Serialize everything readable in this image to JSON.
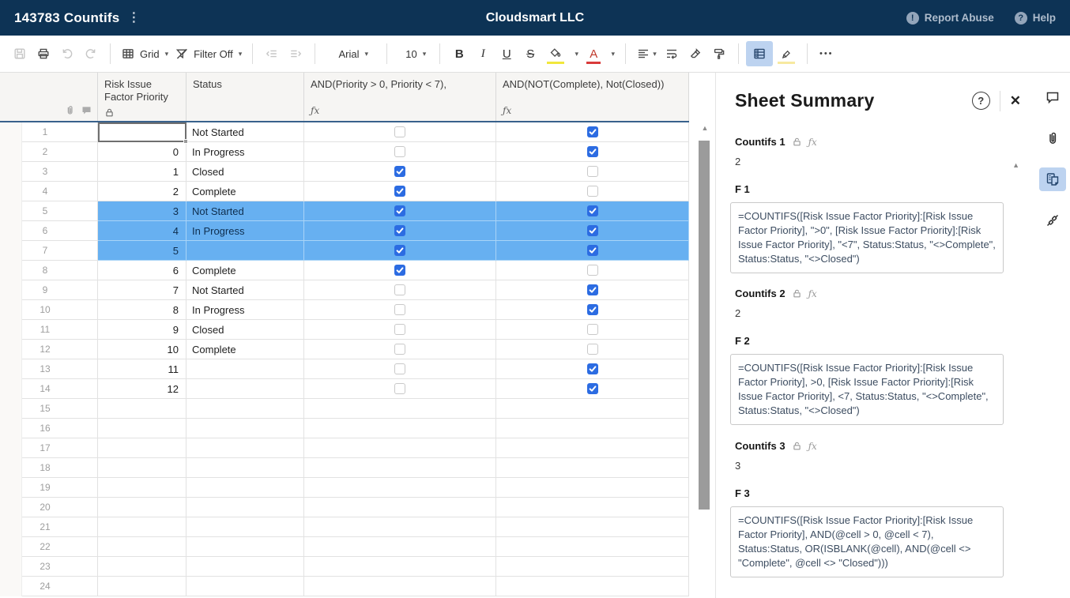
{
  "topbar": {
    "title": "143783 Countifs",
    "company": "Cloudsmart LLC",
    "report_abuse_label": "Report Abuse",
    "help_label": "Help",
    "report_abuse_glyph": "!",
    "help_glyph": "?"
  },
  "toolbar": {
    "view_label": "Grid",
    "filter_label": "Filter Off",
    "font_family_value": "Arial",
    "font_size_value": "10",
    "bold_glyph": "B",
    "italic_glyph": "I",
    "underline_glyph": "U",
    "strikethrough_glyph": "S",
    "more_glyph": "•••"
  },
  "grid": {
    "columns": [
      {
        "title": "Risk Issue Factor Priority",
        "locked": true
      },
      {
        "title": "Status"
      },
      {
        "title": "AND(Priority > 0, Priority < 7),",
        "formula": true
      },
      {
        "title": "AND(NOT(Complete), Not(Closed))",
        "formula": true
      }
    ],
    "fx_glyph": "ƒx",
    "rows": [
      {
        "n": "1",
        "priority": "",
        "status": "Not Started",
        "f1": "unchecked",
        "f2": "checked",
        "highlight": false,
        "active": true
      },
      {
        "n": "2",
        "priority": "0",
        "status": "In Progress",
        "f1": "unchecked",
        "f2": "checked",
        "highlight": false
      },
      {
        "n": "3",
        "priority": "1",
        "status": "Closed",
        "f1": "checked",
        "f2": "unchecked",
        "highlight": false
      },
      {
        "n": "4",
        "priority": "2",
        "status": "Complete",
        "f1": "checked",
        "f2": "unchecked",
        "highlight": false
      },
      {
        "n": "5",
        "priority": "3",
        "status": "Not Started",
        "f1": "checked",
        "f2": "checked",
        "highlight": true
      },
      {
        "n": "6",
        "priority": "4",
        "status": "In Progress",
        "f1": "checked",
        "f2": "checked",
        "highlight": true
      },
      {
        "n": "7",
        "priority": "5",
        "status": "",
        "f1": "checked",
        "f2": "checked",
        "highlight": true
      },
      {
        "n": "8",
        "priority": "6",
        "status": "Complete",
        "f1": "checked",
        "f2": "unchecked",
        "highlight": false
      },
      {
        "n": "9",
        "priority": "7",
        "status": "Not Started",
        "f1": "unchecked",
        "f2": "checked",
        "highlight": false
      },
      {
        "n": "10",
        "priority": "8",
        "status": "In Progress",
        "f1": "unchecked",
        "f2": "checked",
        "highlight": false
      },
      {
        "n": "11",
        "priority": "9",
        "status": "Closed",
        "f1": "unchecked",
        "f2": "unchecked",
        "highlight": false
      },
      {
        "n": "12",
        "priority": "10",
        "status": "Complete",
        "f1": "unchecked",
        "f2": "unchecked",
        "highlight": false
      },
      {
        "n": "13",
        "priority": "11",
        "status": "",
        "f1": "unchecked",
        "f2": "checked",
        "highlight": false
      },
      {
        "n": "14",
        "priority": "12",
        "status": "",
        "f1": "unchecked",
        "f2": "checked",
        "highlight": false
      },
      {
        "n": "15",
        "priority": "",
        "status": "",
        "f1": "none",
        "f2": "none",
        "highlight": false
      },
      {
        "n": "16",
        "priority": "",
        "status": "",
        "f1": "none",
        "f2": "none",
        "highlight": false
      },
      {
        "n": "17",
        "priority": "",
        "status": "",
        "f1": "none",
        "f2": "none",
        "highlight": false
      },
      {
        "n": "18",
        "priority": "",
        "status": "",
        "f1": "none",
        "f2": "none",
        "highlight": false
      },
      {
        "n": "19",
        "priority": "",
        "status": "",
        "f1": "none",
        "f2": "none",
        "highlight": false
      },
      {
        "n": "20",
        "priority": "",
        "status": "",
        "f1": "none",
        "f2": "none",
        "highlight": false
      },
      {
        "n": "21",
        "priority": "",
        "status": "",
        "f1": "none",
        "f2": "none",
        "highlight": false
      },
      {
        "n": "22",
        "priority": "",
        "status": "",
        "f1": "none",
        "f2": "none",
        "highlight": false
      },
      {
        "n": "23",
        "priority": "",
        "status": "",
        "f1": "none",
        "f2": "none",
        "highlight": false
      },
      {
        "n": "24",
        "priority": "",
        "status": "",
        "f1": "none",
        "f2": "none",
        "highlight": false
      }
    ]
  },
  "summary_panel": {
    "title": "Sheet Summary",
    "help_glyph": "?",
    "close_glyph": "✕",
    "fields": [
      {
        "name": "Countifs 1",
        "value": "2",
        "formula_label": "F 1",
        "formula": "=COUNTIFS([Risk Issue Factor Priority]:[Risk Issue Factor Priority], \">0\", [Risk Issue Factor Priority]:[Risk Issue Factor Priority], \"<7\", Status:Status, \"<>Complete\", Status:Status, \"<>Closed\")"
      },
      {
        "name": "Countifs 2",
        "value": "2",
        "formula_label": "F 2",
        "formula": "=COUNTIFS([Risk Issue Factor Priority]:[Risk Issue Factor Priority], >0, [Risk Issue Factor Priority]:[Risk Issue Factor Priority], <7, Status:Status, \"<>Complete\", Status:Status, \"<>Closed\")"
      },
      {
        "name": "Countifs 3",
        "value": "3",
        "formula_label": "F 3",
        "formula": "=COUNTIFS([Risk Issue Factor Priority]:[Risk Issue Factor Priority], AND(@cell > 0, @cell < 7), Status:Status, OR(ISBLANK(@cell), AND(@cell <> \"Complete\", @cell <> \"Closed\")))"
      }
    ]
  },
  "colors": {
    "topbar_bg": "#0d3355",
    "row_highlight": "#67b0f1",
    "checkbox_checked": "#2c6ce2",
    "active_button_bg": "#bdd3f0",
    "header_rule": "#38618c",
    "fill_swatch": "#f1e73c",
    "font_color_swatch": "#d93a3a",
    "highlighter_swatch": "#f7e9a0"
  }
}
